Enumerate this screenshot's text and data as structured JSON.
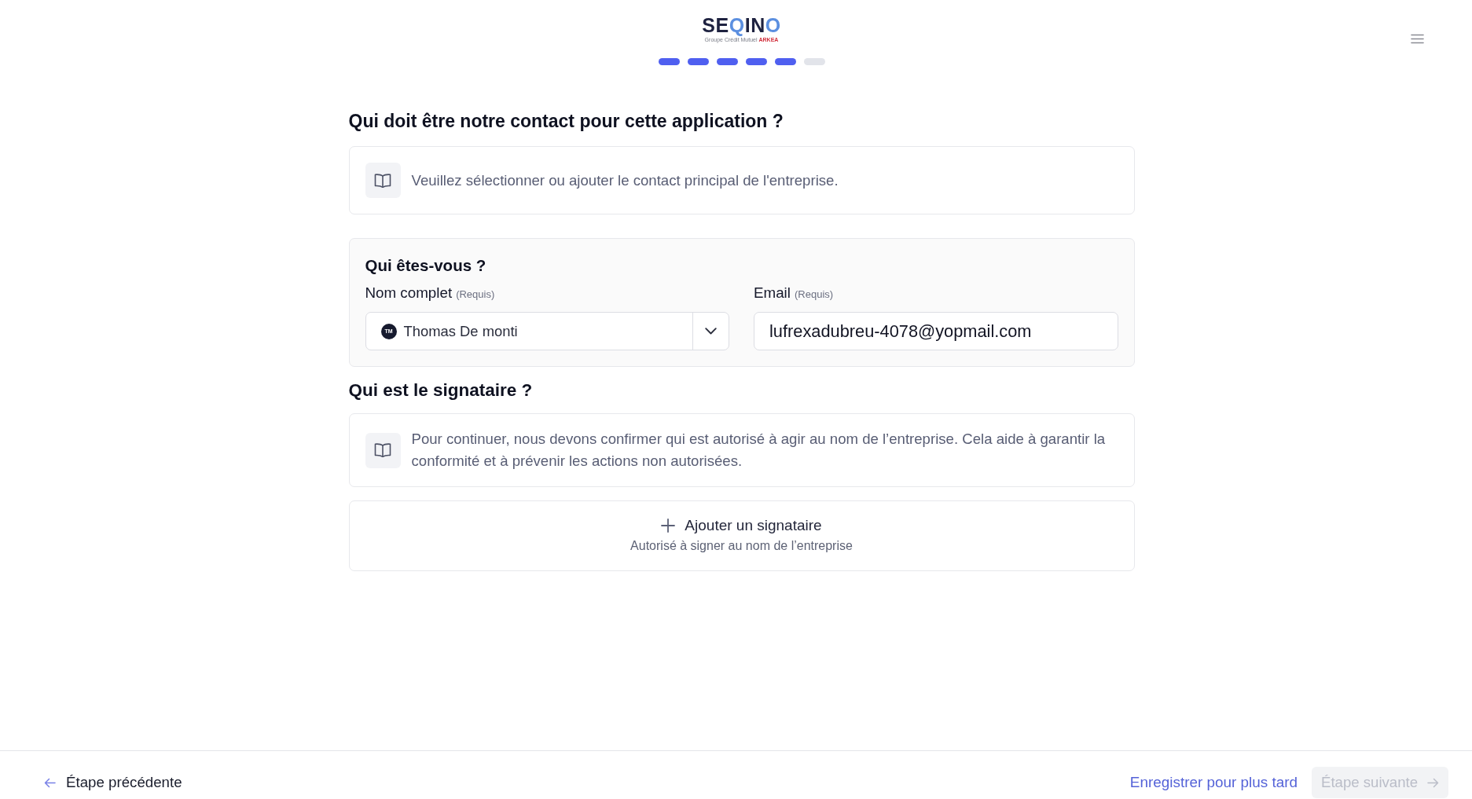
{
  "header": {
    "logo": {
      "wordmark": "SEQINO",
      "group": "Groupe Crédit Mutuel",
      "brand": "ARKEA"
    },
    "progress_steps": [
      {
        "completed": true
      },
      {
        "completed": true
      },
      {
        "completed": true
      },
      {
        "completed": true
      },
      {
        "completed": true
      },
      {
        "completed": false
      }
    ]
  },
  "contact_section": {
    "title": "Qui doit être notre contact pour cette application ?",
    "info": "Veuillez sélectionner ou ajouter le contact principal de l'entreprise."
  },
  "identity_card": {
    "title": "Qui êtes-vous ?",
    "fields": [
      {
        "kind": "select",
        "label": "Nom complet",
        "required_note": "(Requis)",
        "avatar_initials": "TM",
        "value": "Thomas De monti"
      },
      {
        "kind": "text",
        "label": "Email",
        "required_note": "(Requis)",
        "value": "lufrexadubreu-4078@yopmail.com"
      }
    ]
  },
  "signatory_section": {
    "title": "Qui est le signataire ?",
    "info": "Pour continuer, nous devons confirmer qui est autorisé à agir au nom de l’entreprise. Cela aide à garantir la conformité et à prévenir les actions non autorisées.",
    "add_button": {
      "label": "Ajouter un signataire",
      "hint": "Autorisé à signer au nom de l’entreprise"
    }
  },
  "footer": {
    "back_button": {
      "label": "Étape précédente"
    },
    "save_link": {
      "label": "Enregistrer pour plus tard"
    },
    "next_button": {
      "label": "Étape suivante",
      "disabled": true
    }
  }
}
